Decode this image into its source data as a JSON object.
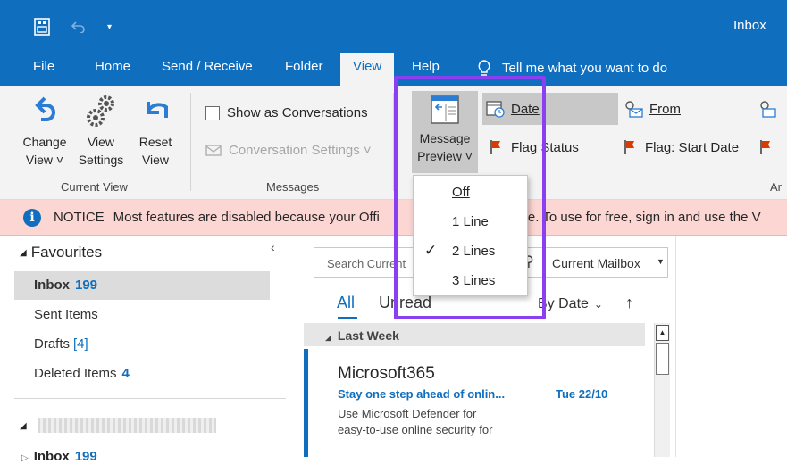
{
  "window": {
    "title": "Inbox"
  },
  "tabs": [
    {
      "label": "File"
    },
    {
      "label": "Home"
    },
    {
      "label": "Send / Receive"
    },
    {
      "label": "Folder"
    },
    {
      "label": "View"
    },
    {
      "label": "Help"
    }
  ],
  "tell_me": "Tell me what you want to do",
  "ribbon": {
    "change_view": {
      "line1": "Change",
      "line2": "View ˅"
    },
    "view_settings": {
      "line1": "View",
      "line2": "Settings"
    },
    "reset_view": {
      "line1": "Reset",
      "line2": "View"
    },
    "current_view_group": "Current View",
    "show_as_conversations": "Show as Conversations",
    "conversation_settings": "Conversation Settings ˅",
    "messages_group": "Messages",
    "message_preview": {
      "line1": "Message",
      "line2": "Preview ˅"
    },
    "arrangement": {
      "date": "Date",
      "from": "From",
      "flag_status": "Flag Status",
      "flag_start_date": "Flag: Start Date",
      "group_label_partial": "Ar"
    }
  },
  "preview_menu": {
    "items": [
      {
        "label": "Off",
        "checked": false
      },
      {
        "label": "1 Line",
        "checked": false
      },
      {
        "label": "2 Lines",
        "checked": true
      },
      {
        "label": "3 Lines",
        "checked": false
      }
    ]
  },
  "notice": {
    "label": "NOTICE",
    "text_left": "Most features are disabled because your Offi",
    "text_right": "tive. To use for free, sign in and use the V"
  },
  "folders": {
    "favourites_label": "Favourites",
    "items": [
      {
        "name": "Inbox",
        "count": "199"
      },
      {
        "name": "Sent Items",
        "count": ""
      },
      {
        "name": "Drafts",
        "count": "[4]"
      },
      {
        "name": "Deleted Items",
        "count": "4"
      }
    ],
    "bottom_inbox": {
      "name": "Inbox",
      "count": "199"
    }
  },
  "message_list": {
    "search_placeholder": "Search Current",
    "scope": "Current Mailbox",
    "filter_all": "All",
    "filter_unread": "Unread",
    "sort": "By Date",
    "group_header": "Last Week",
    "messages": [
      {
        "sender": "Microsoft365",
        "subject": "Stay one step ahead of onlin...",
        "date": "Tue 22/10",
        "preview_line1": "Use Microsoft Defender for",
        "preview_line2": "easy-to-use online security for"
      }
    ]
  },
  "colors": {
    "accent": "#106ebe",
    "highlight": "#8a3ff0",
    "notice_bg": "#fbd6d3"
  }
}
